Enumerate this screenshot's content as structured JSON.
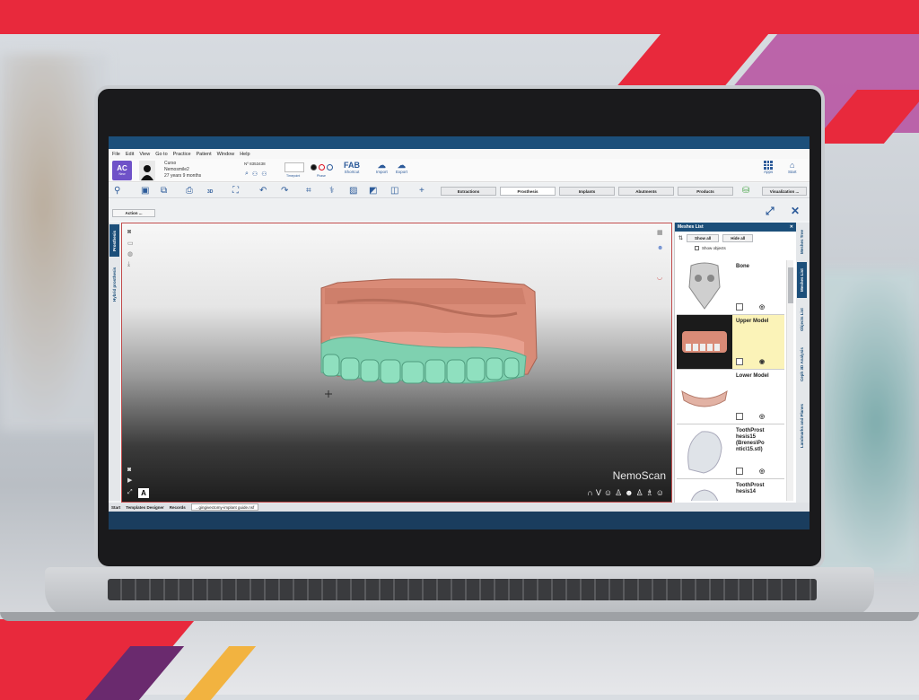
{
  "window": {
    "menu": [
      "File",
      "Edit",
      "View",
      "Go to",
      "Practice",
      "Patient",
      "Window",
      "Help"
    ]
  },
  "header": {
    "badge": "AC",
    "badge_sub": "New",
    "patient_line1": "Curso",
    "patient_line2": "Nemosmile2",
    "patient_line3": "27 years 9 months",
    "patient_id": "Nº 8353438",
    "timepoint_label": "Timepoint",
    "phase_label": "Phase",
    "fab_label": "FAB",
    "shortcut_label": "Shortcut",
    "import_label": "Import",
    "export_label": "Export",
    "apps_label": "Apps",
    "start_label": "Start"
  },
  "toolbar": {
    "tabs": [
      "Extractions",
      "Prosthesis",
      "Implants",
      "Abutments",
      "Products"
    ],
    "active_tab": "Prosthesis",
    "visualization_label": "Visualization ...",
    "action_label": "Action ...",
    "threed_label": "3D"
  },
  "left_tabs": [
    "Prosthesis",
    "Hybrid prosthesis"
  ],
  "viewport": {
    "brand": "NemoScan",
    "label_a": "A"
  },
  "meshes_panel": {
    "title": "Meshes List",
    "show_all": "Show all",
    "hide_all": "Hide all",
    "show_objects": "Show objects",
    "items": [
      {
        "name": "Bone",
        "selected": false
      },
      {
        "name": "Upper Model",
        "selected": true
      },
      {
        "name": "Lower Model",
        "selected": false
      },
      {
        "name": "ToothProst hesis15 (Brenes\\Po ntic\\15.stl)",
        "selected": false
      },
      {
        "name": "ToothProst hesis14",
        "selected": false
      }
    ]
  },
  "right_tabs": [
    "Meshes Tree",
    "Meshes List",
    "Objects List",
    "Ceph 3D Analysis",
    "Landmarks and Planes"
  ],
  "statusbar": {
    "items": [
      "Start",
      "Templates Designer",
      "Records"
    ],
    "document": "...gingivectomy-implant guide.nsf"
  },
  "colors": {
    "accent_red": "#e8293c",
    "accent_purple": "#b64fa0",
    "app_blue": "#1c4f7a",
    "gum": "#d98b77",
    "teeth": "#7fd1b0"
  }
}
